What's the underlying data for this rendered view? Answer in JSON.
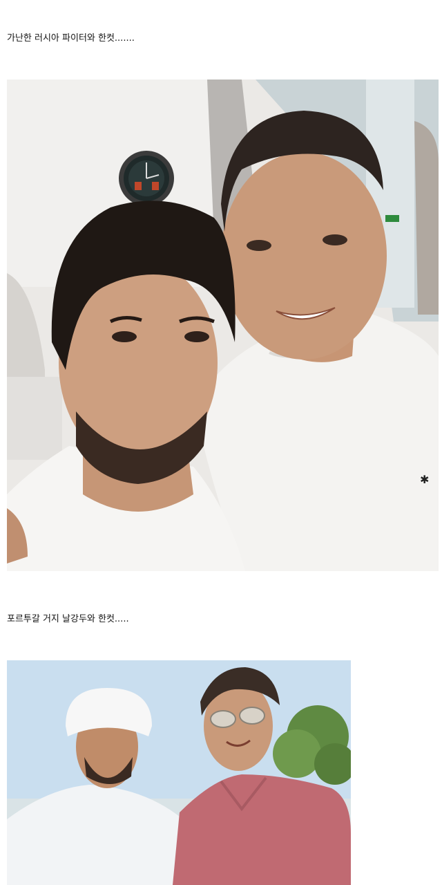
{
  "posts": [
    {
      "caption": "가난한 러시아 파이터와 한컷......."
    },
    {
      "caption": "포르투갈 거지 날강두와 한컷....."
    }
  ]
}
